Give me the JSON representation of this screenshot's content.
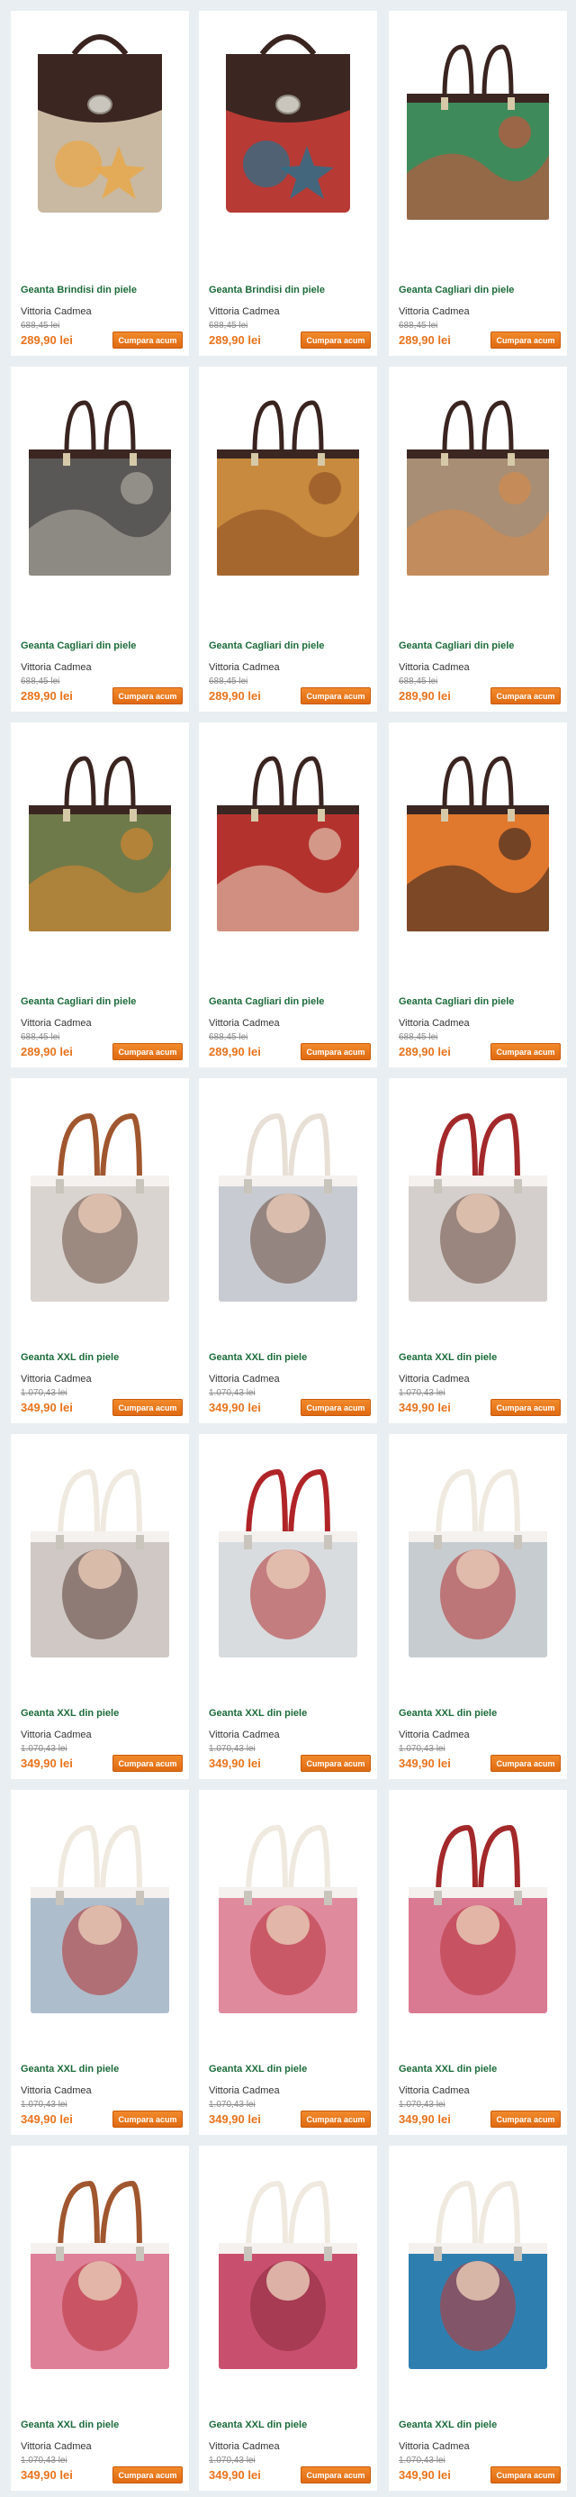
{
  "buy_label": "Cumpara acum",
  "products": [
    {
      "title": "Geanta Brindisi din piele",
      "brand": "Vittoria Cadmea",
      "old_price": "688,45 lei",
      "price": "289,90 lei",
      "style": "flap",
      "handle": "#3a2420",
      "top": "#3b2622",
      "body": "#c9b9a2",
      "accent": "#e8a84a",
      "icon": "starfish-seashell-print"
    },
    {
      "title": "Geanta Brindisi din piele",
      "brand": "Vittoria Cadmea",
      "old_price": "688,45 lei",
      "price": "289,90 lei",
      "style": "flap",
      "handle": "#3a2420",
      "top": "#3b2622",
      "body": "#b83a34",
      "accent": "#2f6f8a",
      "icon": "ornamental-red-print"
    },
    {
      "title": "Geanta Cagliari din piele",
      "brand": "Vittoria Cadmea",
      "old_price": "688,45 lei",
      "price": "289,90 lei",
      "style": "tote",
      "handle": "#3a2420",
      "top": "#3b2622",
      "body": "#3f8a5a",
      "accent": "#d94f3a",
      "icon": "abstract-colorful-print"
    },
    {
      "title": "Geanta Cagliari din piele",
      "brand": "Vittoria Cadmea",
      "old_price": "688,45 lei",
      "price": "289,90 lei",
      "style": "tote",
      "handle": "#3a2420",
      "top": "#3b2622",
      "body": "#5a5856",
      "accent": "#b8b3aa",
      "icon": "city-night-print"
    },
    {
      "title": "Geanta Cagliari din piele",
      "brand": "Vittoria Cadmea",
      "old_price": "688,45 lei",
      "price": "289,90 lei",
      "style": "tote",
      "handle": "#3a2420",
      "top": "#3b2622",
      "body": "#c78a3e",
      "accent": "#8a4a22",
      "icon": "colosseum-print"
    },
    {
      "title": "Geanta Cagliari din piele",
      "brand": "Vittoria Cadmea",
      "old_price": "688,45 lei",
      "price": "289,90 lei",
      "style": "tote",
      "handle": "#3a2420",
      "top": "#3b2622",
      "body": "#a88e74",
      "accent": "#d98a48",
      "icon": "starfish-seashell-print"
    },
    {
      "title": "Geanta Cagliari din piele",
      "brand": "Vittoria Cadmea",
      "old_price": "688,45 lei",
      "price": "289,90 lei",
      "style": "tote",
      "handle": "#3a2420",
      "top": "#3b2622",
      "body": "#6f7a4a",
      "accent": "#e0892e",
      "icon": "tiger-print"
    },
    {
      "title": "Geanta Cagliari din piele",
      "brand": "Vittoria Cadmea",
      "old_price": "688,45 lei",
      "price": "289,90 lei",
      "style": "tote",
      "handle": "#3a2420",
      "top": "#3b2622",
      "body": "#b3322e",
      "accent": "#e8dcc4",
      "icon": "ornamental-red-print"
    },
    {
      "title": "Geanta Cagliari din piele",
      "brand": "Vittoria Cadmea",
      "old_price": "688,45 lei",
      "price": "289,90 lei",
      "style": "tote",
      "handle": "#3a2420",
      "top": "#3b2622",
      "body": "#e0782e",
      "accent": "#2a2020",
      "icon": "sunset-palm-print"
    },
    {
      "title": "Geanta XXL din piele",
      "brand": "Vittoria Cadmea",
      "old_price": "1.070,43 lei",
      "price": "349,90 lei",
      "style": "xxl",
      "handle": "#a0562e",
      "top": "#f4f1ee",
      "body": "#d9d4d0",
      "accent": "#6a4a3e",
      "icon": "veiled-woman-print"
    },
    {
      "title": "Geanta XXL din piele",
      "brand": "Vittoria Cadmea",
      "old_price": "1.070,43 lei",
      "price": "349,90 lei",
      "style": "xxl",
      "handle": "#e8e0d6",
      "top": "#f4f1ee",
      "body": "#c8ccd2",
      "accent": "#6a4a3e",
      "icon": "veiled-woman-print"
    },
    {
      "title": "Geanta XXL din piele",
      "brand": "Vittoria Cadmea",
      "old_price": "1.070,43 lei",
      "price": "349,90 lei",
      "style": "xxl",
      "handle": "#a3282a",
      "top": "#f4f1ee",
      "body": "#d4cfcc",
      "accent": "#6a4a3e",
      "icon": "veiled-woman-print"
    },
    {
      "title": "Geanta XXL din piele",
      "brand": "Vittoria Cadmea",
      "old_price": "1.070,43 lei",
      "price": "349,90 lei",
      "style": "xxl",
      "handle": "#efe9df",
      "top": "#f4f1ee",
      "body": "#cfc8c4",
      "accent": "#5a3c34",
      "icon": "veiled-woman-print"
    },
    {
      "title": "Geanta XXL din piele",
      "brand": "Vittoria Cadmea",
      "old_price": "1.070,43 lei",
      "price": "349,90 lei",
      "style": "xxl",
      "handle": "#b02428",
      "top": "#f4f1ee",
      "body": "#d8dcdf",
      "accent": "#b3302e",
      "icon": "red-dress-woman-print"
    },
    {
      "title": "Geanta XXL din piele",
      "brand": "Vittoria Cadmea",
      "old_price": "1.070,43 lei",
      "price": "349,90 lei",
      "style": "xxl",
      "handle": "#efe9df",
      "top": "#f4f1ee",
      "body": "#c7ccd0",
      "accent": "#b3302e",
      "icon": "red-dress-woman-print"
    },
    {
      "title": "Geanta XXL din piele",
      "brand": "Vittoria Cadmea",
      "old_price": "1.070,43 lei",
      "price": "349,90 lei",
      "style": "xxl",
      "handle": "#efe9df",
      "top": "#f4f1ee",
      "body": "#aebdcc",
      "accent": "#b3302e",
      "icon": "red-dress-woman-print"
    },
    {
      "title": "Geanta XXL din piele",
      "brand": "Vittoria Cadmea",
      "old_price": "1.070,43 lei",
      "price": "349,90 lei",
      "style": "xxl",
      "handle": "#efe9df",
      "top": "#f4f1ee",
      "body": "#e08a9e",
      "accent": "#b8323a",
      "icon": "pink-woman-blossom-print"
    },
    {
      "title": "Geanta XXL din piele",
      "brand": "Vittoria Cadmea",
      "old_price": "1.070,43 lei",
      "price": "349,90 lei",
      "style": "xxl",
      "handle": "#a3282a",
      "top": "#f4f1ee",
      "body": "#d97a92",
      "accent": "#b8323a",
      "icon": "pink-woman-blossom-print"
    },
    {
      "title": "Geanta XXL din piele",
      "brand": "Vittoria Cadmea",
      "old_price": "1.070,43 lei",
      "price": "349,90 lei",
      "style": "xxl",
      "handle": "#a0562e",
      "top": "#f4f1ee",
      "body": "#dd8098",
      "accent": "#b8323a",
      "icon": "pink-woman-blossom-print"
    },
    {
      "title": "Geanta XXL din piele",
      "brand": "Vittoria Cadmea",
      "old_price": "1.070,43 lei",
      "price": "349,90 lei",
      "style": "xxl",
      "handle": "#efe9df",
      "top": "#f4f1ee",
      "body": "#c8506e",
      "accent": "#8a2a3e",
      "icon": "pink-woman-blossom-print"
    },
    {
      "title": "Geanta XXL din piele",
      "brand": "Vittoria Cadmea",
      "old_price": "1.070,43 lei",
      "price": "349,90 lei",
      "style": "xxl",
      "handle": "#efe9df",
      "top": "#f4f1ee",
      "body": "#2e7fb0",
      "accent": "#c8342e",
      "icon": "blue-mosaic-woman-print"
    }
  ]
}
